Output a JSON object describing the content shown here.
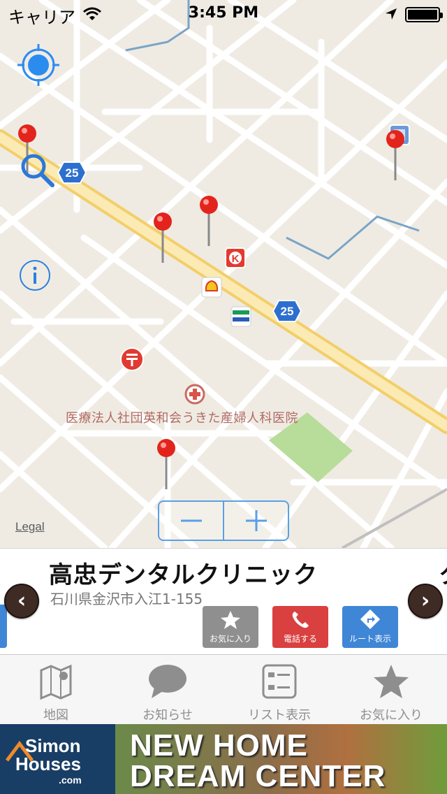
{
  "status_bar": {
    "carrier": "キャリア",
    "time": "3:45 PM"
  },
  "map": {
    "hospital_label": "医療法人社団英和会うきた産婦人科医院",
    "legal_label": "Legal",
    "route_badge": "25",
    "controls": {
      "locate": "locate-me-icon",
      "search": "search-icon",
      "info": "info-icon",
      "zoom_out": "minus-icon",
      "zoom_in": "plus-icon"
    }
  },
  "info_panel": {
    "clinic_name": "高忠デンタルクリニック",
    "clinic_address": "石川県金沢市入江1-155",
    "next_clinic_partial": "ク",
    "prev_arrow": "‹",
    "next_arrow": "›",
    "actions": {
      "favorite": "お気に入り",
      "call": "電話する",
      "route": "ルート表示"
    },
    "colors": {
      "favorite": "#8f8f8f",
      "call": "#d9403f",
      "route": "#3f86d6"
    }
  },
  "tab_bar": {
    "tabs": [
      {
        "label": "地図",
        "icon": "map-icon"
      },
      {
        "label": "お知らせ",
        "icon": "speech-bubble-icon"
      },
      {
        "label": "リスト表示",
        "icon": "list-icon"
      },
      {
        "label": "お気に入り",
        "icon": "star-icon"
      }
    ]
  },
  "ad_banner": {
    "logo_line1": "Simon",
    "logo_line2": "Houses",
    "logo_line3": ".com",
    "headline1": "NEW HOME",
    "headline2": "DREAM CENTER"
  }
}
